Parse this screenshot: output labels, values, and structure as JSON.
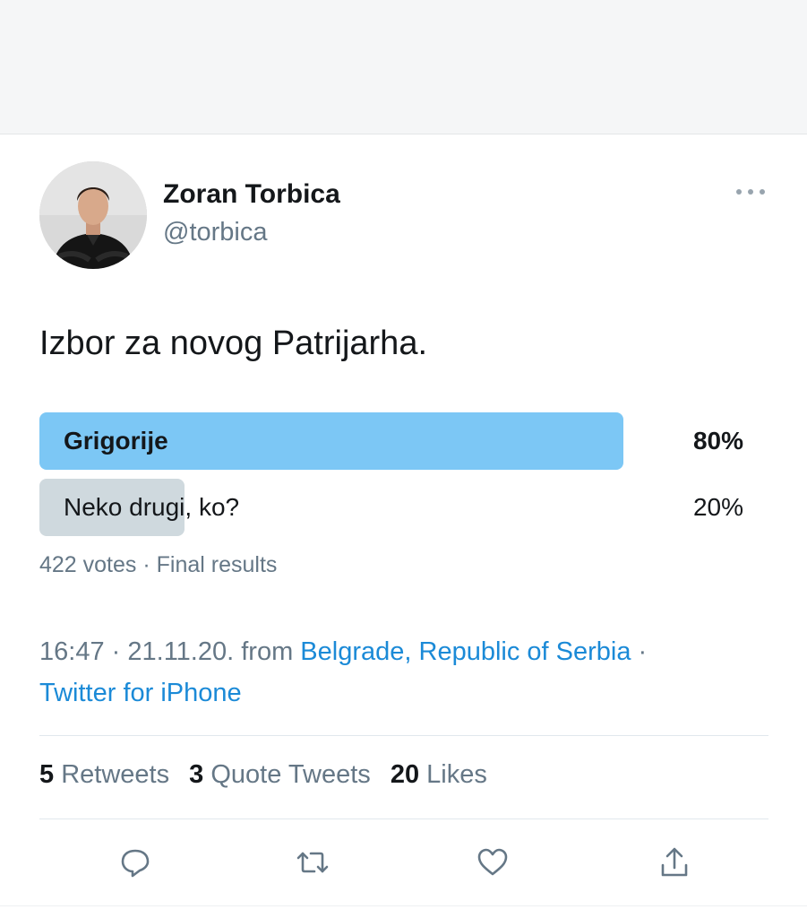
{
  "author": {
    "name": "Zoran Torbica",
    "handle": "@torbica"
  },
  "tweet_text": "Izbor za novog Patrijarha.",
  "poll": {
    "options": [
      {
        "label": "Grigorije",
        "percent_text": "80%",
        "fraction": 0.825,
        "winner": true
      },
      {
        "label": "Neko drugi, ko?",
        "percent_text": "20%",
        "fraction": 0.205,
        "winner": false
      }
    ],
    "votes_text": "422 votes",
    "separator": "·",
    "status_text": "Final results"
  },
  "meta": {
    "time": "16:47",
    "date": "21.11.20.",
    "from_text": "from",
    "location": "Belgrade, Republic of Serbia",
    "source": "Twitter for iPhone"
  },
  "stats": {
    "retweets_count": "5",
    "retweets_label": "Retweets",
    "quotes_count": "3",
    "quotes_label": "Quote Tweets",
    "likes_count": "20",
    "likes_label": "Likes"
  },
  "icons": {
    "more": "more-dots-icon",
    "reply": "reply-icon",
    "retweet": "retweet-icon",
    "like": "heart-icon",
    "share": "share-icon"
  },
  "colors": {
    "link": "#1b8ad7",
    "winner_bar": "#7cc7f5",
    "other_bar": "#cfd9de",
    "secondary_text": "#657786"
  }
}
